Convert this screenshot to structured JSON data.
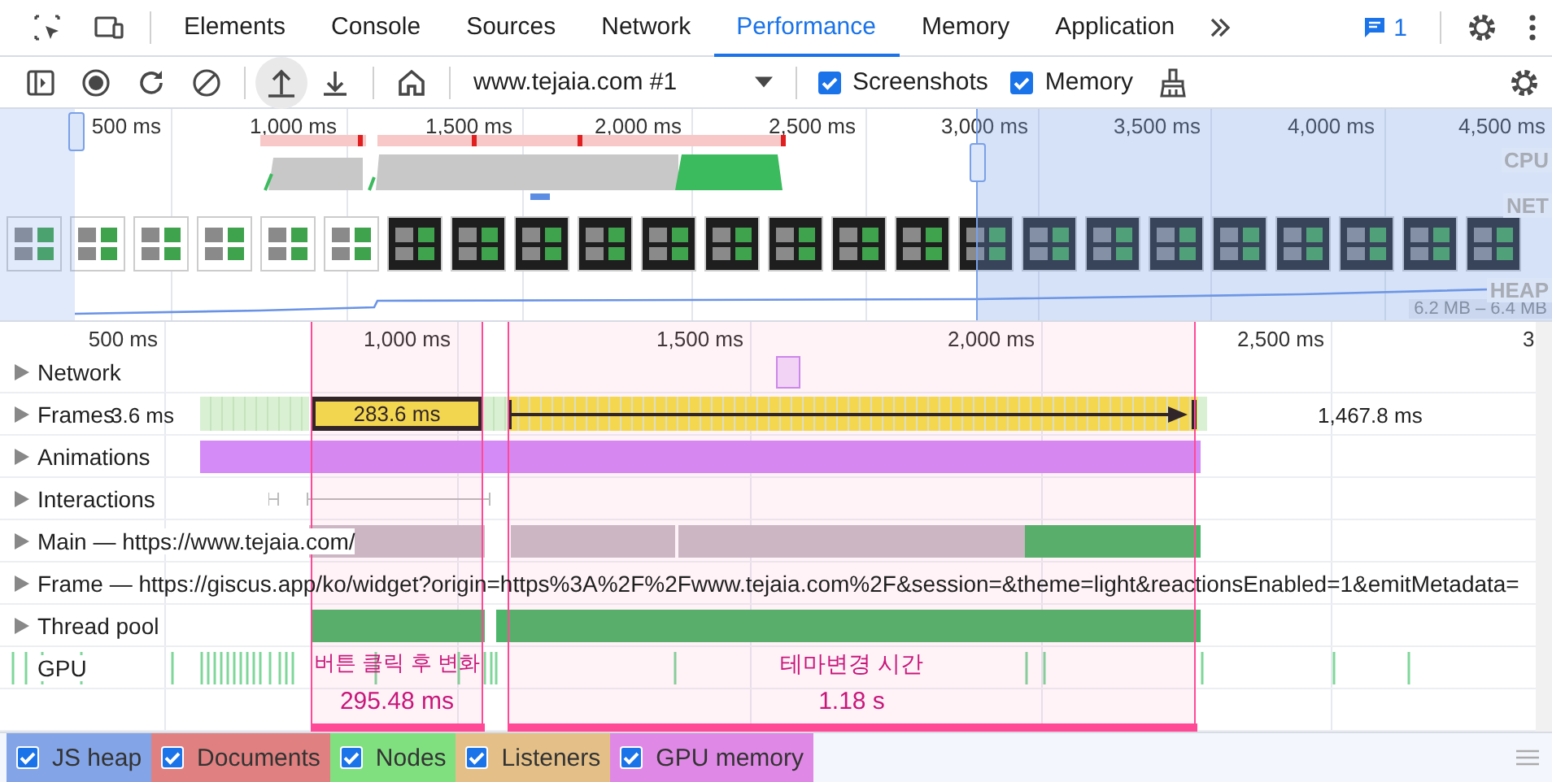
{
  "tabs": [
    {
      "label": "Elements",
      "selected": false
    },
    {
      "label": "Console",
      "selected": false
    },
    {
      "label": "Sources",
      "selected": false
    },
    {
      "label": "Network",
      "selected": false
    },
    {
      "label": "Performance",
      "selected": true
    },
    {
      "label": "Memory",
      "selected": false
    },
    {
      "label": "Application",
      "selected": false
    }
  ],
  "issues": {
    "count": "1"
  },
  "toolbar": {
    "recording": "www.tejaia.com #1",
    "options": [
      {
        "label": "Screenshots",
        "checked": true
      },
      {
        "label": "Memory",
        "checked": true
      }
    ]
  },
  "overview": {
    "ticks": [
      "500 ms",
      "1,000 ms",
      "1,500 ms",
      "2,000 ms",
      "2,500 ms",
      "3,000 ms",
      "3,500 ms",
      "4,000 ms",
      "4,500 ms"
    ],
    "lanes": [
      "CPU",
      "NET",
      "HEAP"
    ],
    "heap_range": "6.2 MB – 6.4 MB",
    "screenshots": [
      {
        "kind": "light"
      },
      {
        "kind": "light"
      },
      {
        "kind": "light"
      },
      {
        "kind": "light"
      },
      {
        "kind": "light"
      },
      {
        "kind": "light"
      },
      {
        "kind": "dark"
      },
      {
        "kind": "dark"
      },
      {
        "kind": "dark"
      },
      {
        "kind": "dark"
      },
      {
        "kind": "dark"
      },
      {
        "kind": "dark"
      },
      {
        "kind": "dark"
      },
      {
        "kind": "dark"
      },
      {
        "kind": "dark"
      },
      {
        "kind": "dark"
      },
      {
        "kind": "dark"
      },
      {
        "kind": "dark"
      },
      {
        "kind": "dark"
      },
      {
        "kind": "dark"
      },
      {
        "kind": "dark"
      },
      {
        "kind": "dark"
      },
      {
        "kind": "dark"
      },
      {
        "kind": "dark"
      }
    ]
  },
  "timeline": {
    "ticks": [
      "500 ms",
      "1,000 ms",
      "1,500 ms",
      "2,000 ms",
      "2,500 ms",
      "3"
    ],
    "tracks": [
      {
        "label": "Network",
        "kind": "network"
      },
      {
        "label": "Frames",
        "kind": "frames",
        "frames": [
          "3.6 ms",
          "283.6 ms",
          "1,467.8 ms"
        ]
      },
      {
        "label": "Animations",
        "kind": "animations"
      },
      {
        "label": "Interactions",
        "kind": "interactions"
      },
      {
        "label": "Main — https://www.tejaia.com/",
        "kind": "main"
      },
      {
        "label": "Frame — https://giscus.app/ko/widget?origin=https%3A%2F%2Fwww.tejaia.com%2F&session=&theme=light&reactionsEnabled=1&emitMetadata=",
        "kind": "frame"
      },
      {
        "label": "Thread pool",
        "kind": "threadpool"
      },
      {
        "label": "GPU",
        "kind": "gpu"
      }
    ],
    "annotations": [
      {
        "label": "버튼 클릭 후 변화",
        "duration": "295.48 ms"
      },
      {
        "label": "테마변경 시간",
        "duration": "1.18 s"
      }
    ]
  },
  "legend": [
    {
      "label": "JS heap",
      "checked": true,
      "color": "#83a4e6"
    },
    {
      "label": "Documents",
      "checked": true,
      "color": "#e08080"
    },
    {
      "label": "Nodes",
      "checked": true,
      "color": "#80e080"
    },
    {
      "label": "Listeners",
      "checked": true,
      "color": "#e4c088"
    },
    {
      "label": "GPU memory",
      "checked": true,
      "color": "#e088e6"
    }
  ]
}
